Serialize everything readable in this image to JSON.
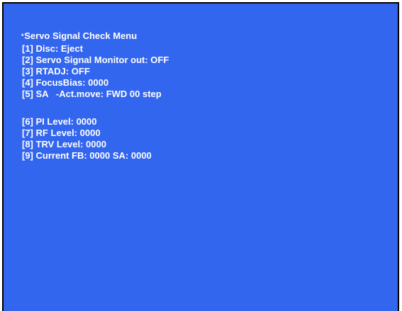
{
  "colors": {
    "background": "#3366ee",
    "text": "#ffffff",
    "border": "#000000"
  },
  "menu": {
    "marker": "*",
    "title": "Servo Signal Check Menu",
    "items": [
      {
        "label": "[1] Disc: Eject"
      },
      {
        "label": "[2] Servo Signal Monitor out: OFF"
      },
      {
        "label": "[3] RTADJ: OFF"
      },
      {
        "label": "[4] FocusBias: 0000"
      },
      {
        "label": "[5] SA   -Act.move: FWD 00 step"
      },
      {
        "label": "[6] PI Level: 0000"
      },
      {
        "label": "[7] RF Level: 0000"
      },
      {
        "label": "[8] TRV Level: 0000"
      },
      {
        "label": "[9] Current FB: 0000 SA: 0000"
      }
    ]
  }
}
